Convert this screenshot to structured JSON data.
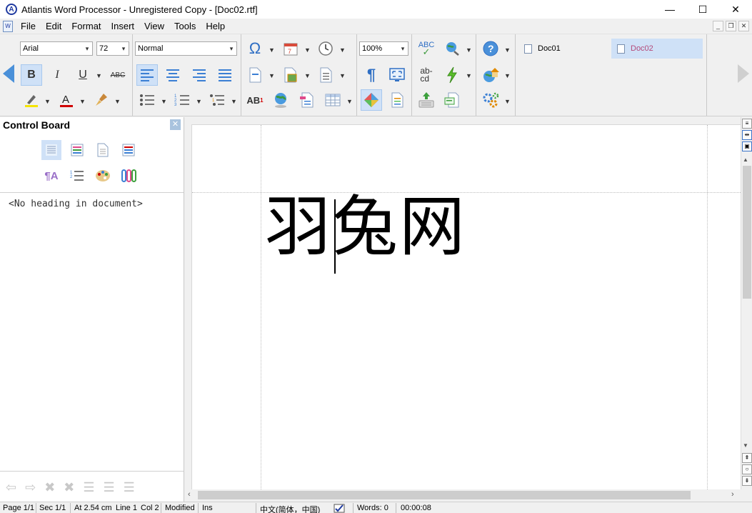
{
  "window": {
    "title": "Atlantis Word Processor - Unregistered Copy - [Doc02.rtf]",
    "logo_letter": "A",
    "minimize": "—",
    "maximize": "☐",
    "close": "✕"
  },
  "menu": {
    "items": [
      "File",
      "Edit",
      "Format",
      "Insert",
      "View",
      "Tools",
      "Help"
    ],
    "doc_icon_text": "W"
  },
  "toolbar": {
    "font_name": "Arial",
    "font_size": "72",
    "style": "Normal",
    "zoom": "100%",
    "bold": "B",
    "italic": "I",
    "underline": "U",
    "strike": "ABC",
    "abc_spell": "ABC",
    "hyphen": "ab-\ncd",
    "superscript_label": "AB",
    "superscript_mark": "1",
    "doc_tabs": [
      {
        "label": "Doc01",
        "active": false
      },
      {
        "label": "Doc02",
        "active": true
      }
    ]
  },
  "control_board": {
    "title": "Control Board",
    "empty_message": "<No heading in document>"
  },
  "document": {
    "text": "羽兔网"
  },
  "status": {
    "page": "Page 1/1",
    "section": "Sec 1/1",
    "at": "At 2.54 cm",
    "line": "Line 1",
    "col": "Col 2",
    "modified": "Modified",
    "mode": "Ins",
    "language": "中文(简体，中国)",
    "words": "Words: 0",
    "time": "00:00:08"
  }
}
